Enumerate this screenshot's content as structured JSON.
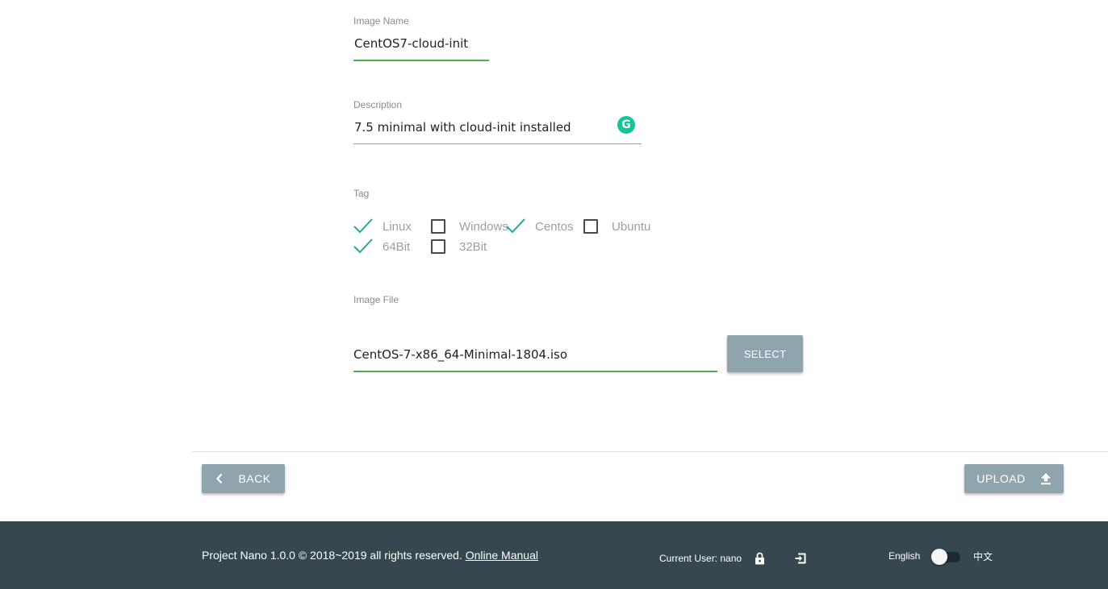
{
  "form": {
    "image_name": {
      "label": "Image Name",
      "value": "CentOS7-cloud-init"
    },
    "description": {
      "label": "Description",
      "value": "7.5 minimal with cloud-init installed",
      "assistant_badge": "G"
    },
    "tag": {
      "label": "Tag",
      "options": [
        {
          "label": "Linux",
          "checked": true
        },
        {
          "label": "Windows",
          "checked": false
        },
        {
          "label": "Centos",
          "checked": true
        },
        {
          "label": "Ubuntu",
          "checked": false
        },
        {
          "label": "64Bit",
          "checked": true
        },
        {
          "label": "32Bit",
          "checked": false
        }
      ]
    },
    "image_file": {
      "label": "Image File",
      "value": "CentOS-7-x86_64-Minimal-1804.iso",
      "select_label": "SELECT"
    }
  },
  "actions": {
    "back_label": "BACK",
    "upload_label": "UPLOAD"
  },
  "footer": {
    "copyright": "Project Nano 1.0.0 © 2018~2019 all rights reserved.",
    "manual_link": "Online Manual",
    "current_user": "Current User: nano",
    "lang_en": "English",
    "lang_zh": "中文",
    "lang_toggle_on": false
  },
  "icons": {
    "check": "check-icon",
    "back": "chevron-left-icon",
    "upload": "upload-icon",
    "lock": "lock-icon",
    "logout": "logout-icon"
  },
  "colors": {
    "accent_green": "#4caf50",
    "check_teal": "#26a69a",
    "button": "#90a4ae",
    "footer_bg": "#37474f",
    "grammarly": "#15c39a"
  }
}
